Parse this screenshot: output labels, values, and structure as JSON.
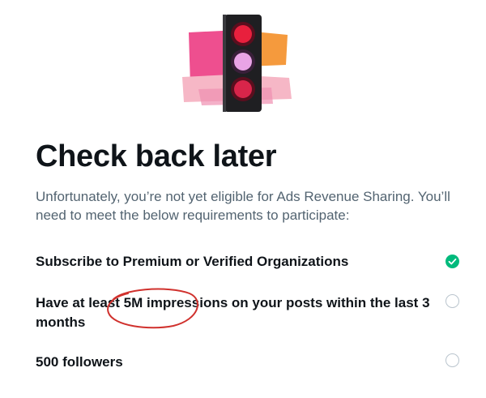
{
  "hero": {
    "icon": "traffic-light-illustration"
  },
  "title": "Check back later",
  "subtitle": "Unfortunately, you’re not yet eligible for Ads Revenue Sharing. You’ll need to meet the below requirements to participate:",
  "requirements": [
    {
      "label": "Subscribe to Premium or Verified Organizations",
      "met": true
    },
    {
      "label": "Have at least 5M impressions on your posts within the last 3 months",
      "met": false
    },
    {
      "label": "500 followers",
      "met": false
    }
  ],
  "colors": {
    "met": "#00ba7c",
    "pending_border": "#b9c4cd",
    "subtitle": "#536471",
    "annotation": "#d0312d"
  }
}
